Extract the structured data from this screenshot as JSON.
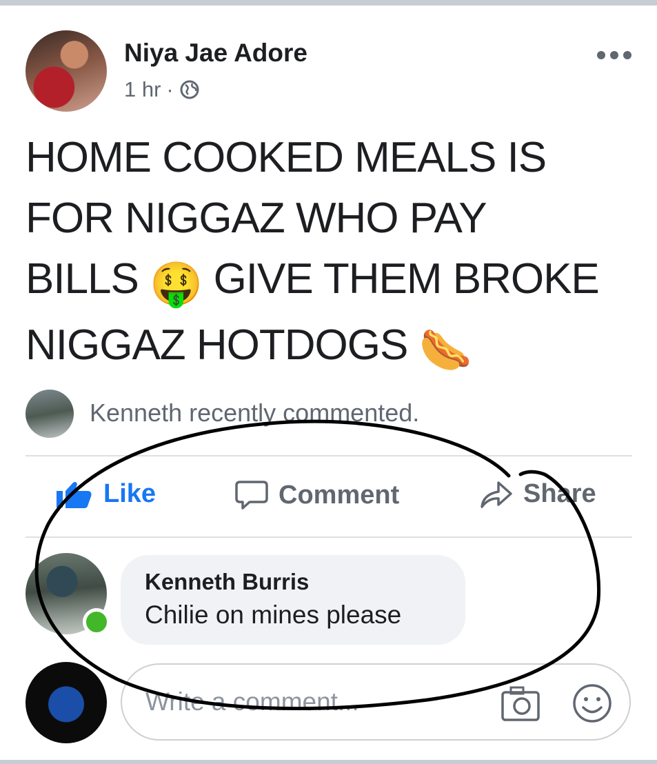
{
  "post": {
    "author": "Niya Jae Adore",
    "time": "1 hr",
    "separator": "·",
    "text_lines": [
      "HOME COOKED MEALS IS",
      "FOR NIGGAZ WHO PAY",
      "BILLS",
      "GIVE THEM BROKE",
      "NIGGAZ HOTDOGS"
    ],
    "emoji_1": "🤑",
    "emoji_2": "🌭"
  },
  "activity": {
    "text": "Kenneth recently commented."
  },
  "actions": {
    "like": "Like",
    "comment": "Comment",
    "share": "Share"
  },
  "comment": {
    "author": "Kenneth Burris",
    "text": "Chilie on mines please"
  },
  "composer": {
    "placeholder": "Write a comment..."
  },
  "colors": {
    "like_blue": "#1877f2",
    "online_green": "#42b72a",
    "scribble": "#000000"
  },
  "icons": [
    "more-icon",
    "globe-icon",
    "like-icon",
    "comment-icon",
    "share-icon",
    "camera-icon",
    "smiley-icon"
  ]
}
